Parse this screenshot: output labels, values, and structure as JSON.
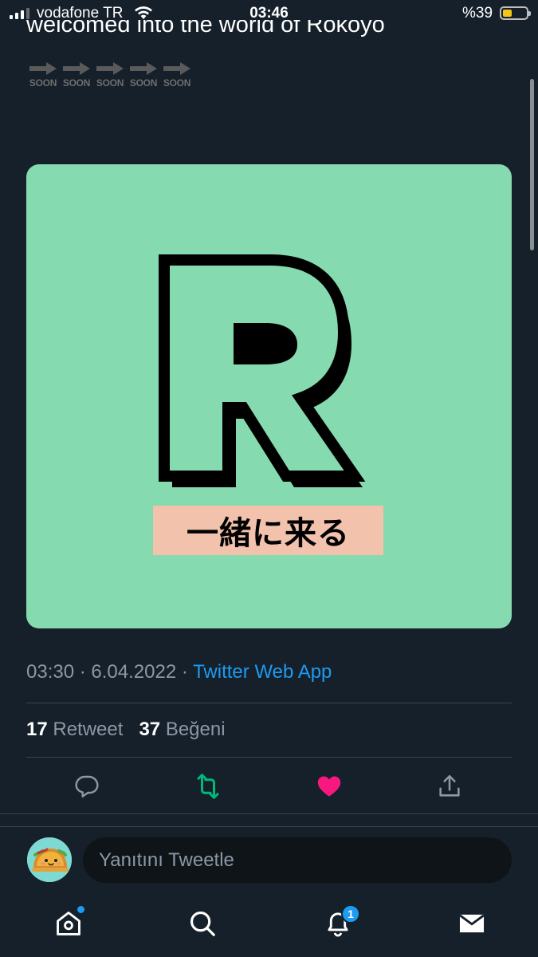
{
  "status_bar": {
    "carrier": "vodafone TR",
    "time": "03:46",
    "battery_percent": "%39",
    "battery_level": 0.39,
    "battery_color": "#f5c518"
  },
  "tweet": {
    "text": "welcomed into the world of Rokoyo",
    "soon_items": [
      "SOON",
      "SOON",
      "SOON",
      "SOON",
      "SOON"
    ],
    "image": {
      "background_color": "#86dab0",
      "banner_text": "一緒に来る",
      "banner_color": "#f3c2ad"
    },
    "time": "03:30",
    "date": "6.04.2022",
    "separator": "·",
    "source_app": "Twitter Web App",
    "retweet_count": "17",
    "retweet_label": "Retweet",
    "like_count": "37",
    "like_label": "Beğeni"
  },
  "actions": {
    "reply_icon": "reply-icon",
    "retweet_icon": "retweet-icon",
    "like_icon": "heart-icon",
    "share_icon": "share-icon",
    "retweet_active_color": "#00ba7c",
    "like_active_color": "#f91880"
  },
  "reply": {
    "placeholder": "Yanıtını Tweetle"
  },
  "bottom_nav": {
    "items": [
      "home-icon",
      "search-icon",
      "notifications-icon",
      "messages-icon"
    ],
    "notification_count": "1"
  }
}
